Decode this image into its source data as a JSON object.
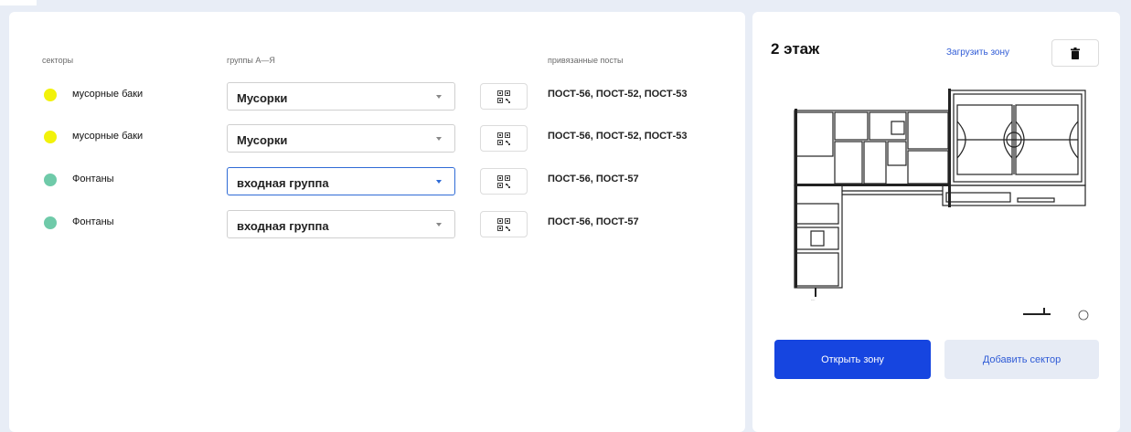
{
  "table": {
    "headers": {
      "sectors": "секторы",
      "groups": "группы А—Я",
      "posts": "привязанные посты"
    },
    "rows": [
      {
        "sector": "мусорные баки",
        "dot_color": "#f2f20a",
        "group": "Мусорки",
        "posts": "ПОСТ-56, ПОСТ-52, ПОСТ-53",
        "active": false
      },
      {
        "sector": "мусорные баки",
        "dot_color": "#f2f20a",
        "group": "Мусорки",
        "posts": "ПОСТ-56, ПОСТ-52, ПОСТ-53",
        "active": false
      },
      {
        "sector": "Фонтаны",
        "dot_color": "#6fcaa9",
        "group": "входная группа",
        "posts": "ПОСТ-56, ПОСТ-57",
        "active": true
      },
      {
        "sector": "Фонтаны",
        "dot_color": "#6fcaa9",
        "group": "входная группа",
        "posts": "ПОСТ-56, ПОСТ-57",
        "active": false
      }
    ]
  },
  "zone": {
    "floor_title": "2 этаж",
    "upload_label": "Загрузить зону",
    "open_label": "Открыть зону",
    "add_sector_label": "Добавить сектор"
  },
  "colors": {
    "accent": "#1645e0",
    "link": "#2f5bd6",
    "background": "#e8edf6"
  },
  "icons": {
    "qr": "qr-code-icon",
    "trash": "trash-icon",
    "dropdown": "chevron-down-icon"
  }
}
